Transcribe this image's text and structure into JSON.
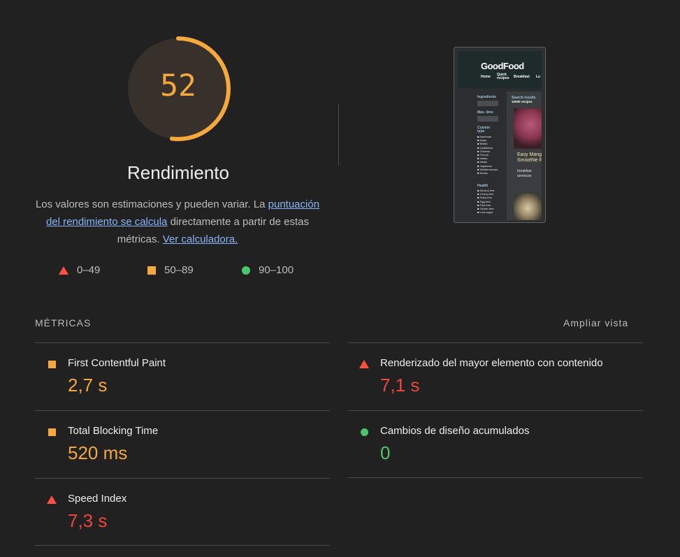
{
  "gauge": {
    "score": "52",
    "score_fraction": 0.52,
    "title": "Rendimiento",
    "color": "#f5a83c"
  },
  "description": {
    "text_before": "Los valores son estimaciones y pueden variar. La ",
    "link1": "puntuación del rendimiento se calcula",
    "text_middle": " directamente a partir de estas métricas. ",
    "link2": "Ver calculadora."
  },
  "legend": {
    "fail": "0–49",
    "average": "50–89",
    "pass": "90–100",
    "colors": {
      "fail": "#ff4e42",
      "average": "#f5a83c",
      "pass": "#4ac76b"
    }
  },
  "thumbnail": {
    "brand": "GoodFood",
    "nav": [
      "Home",
      "Quick recipes",
      "Breakfast",
      "Lu"
    ],
    "ingredients_label": "Ingredients",
    "max_time_label": "Max. time",
    "cuisine_label": "Cuisine type",
    "cuisines": [
      "American",
      "Asian",
      "British",
      "Caribbean",
      "Chinese",
      "French",
      "Indian",
      "Italian",
      "Japanese",
      "Mediterranean",
      "Nordic"
    ],
    "health_label": "Health",
    "health": [
      "Alcohol-free",
      "Celery-free",
      "Dairy-free",
      "Egg-free",
      "Fish-free",
      "Gluten-free",
      "Low-sugar"
    ],
    "results_title": "Search results",
    "results_count": "10000 recipes",
    "recipe_title_line1": "Easy Mango",
    "recipe_title_line2": "Smoothie R",
    "recipe_tag1": "breakfast",
    "recipe_tag2": "american"
  },
  "metrics": {
    "header": "MÉTRICAS",
    "expand_label": "Ampliar vista",
    "items": [
      {
        "title": "First Contentful Paint",
        "value": "2,7 s",
        "rating": "average"
      },
      {
        "title": "Renderizado del mayor elemento con contenido",
        "value": "7,1 s",
        "rating": "fail"
      },
      {
        "title": "Total Blocking Time",
        "value": "520 ms",
        "rating": "average"
      },
      {
        "title": "Cambios de diseño acumulados",
        "value": "0",
        "rating": "pass"
      },
      {
        "title": "Speed Index",
        "value": "7,3 s",
        "rating": "fail"
      }
    ]
  }
}
